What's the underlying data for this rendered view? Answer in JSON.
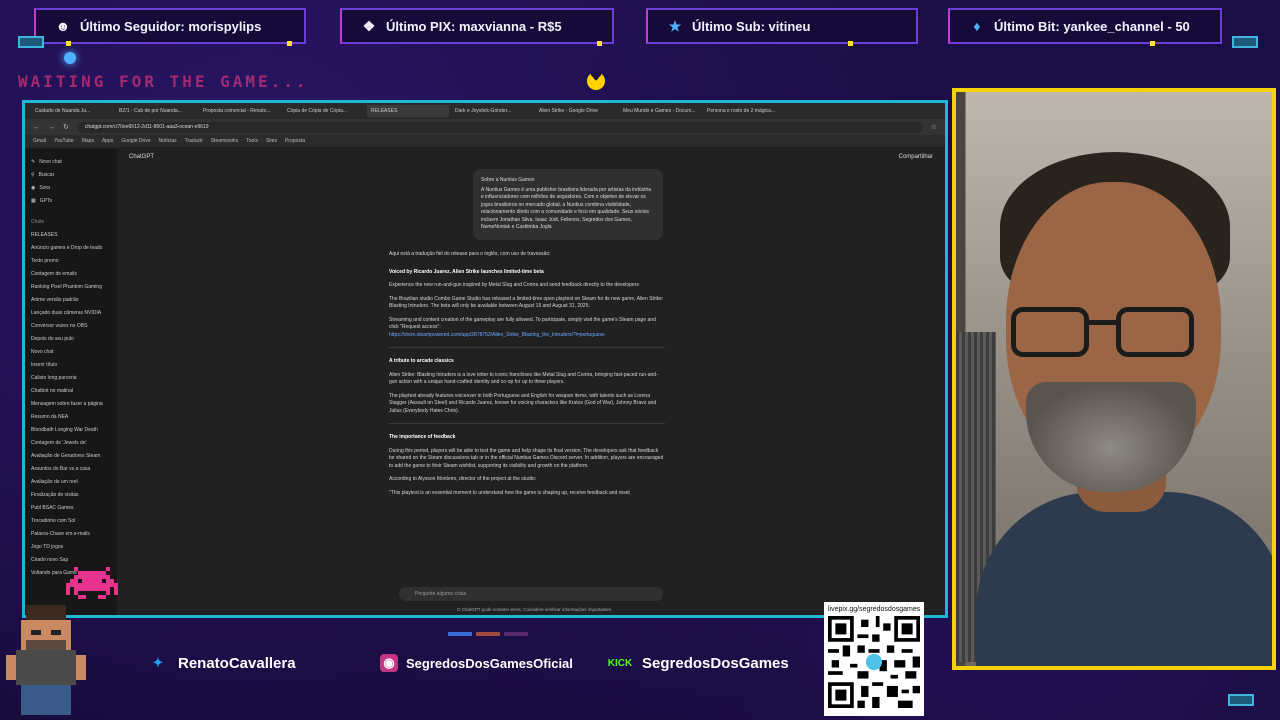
{
  "alerts": [
    {
      "icon": "user-icon",
      "text": "Último Seguidor: morispylips"
    },
    {
      "icon": "pix-icon",
      "text": "Último PIX: maxvianna - R$5"
    },
    {
      "icon": "star-icon",
      "text": "Último Sub: vitineu"
    },
    {
      "icon": "diamond-icon",
      "text": "Último Bit: yankee_channel - 50"
    }
  ],
  "waiting_text": "WAITING FOR THE GAME...",
  "browser": {
    "tabs": [
      "Cuidado de Nuanda Ju...",
      "BZ/1 - Cub de por Nuanda...",
      "Proposta comercial - Renato...",
      "Cópia de Cópia de Cópia...",
      "RELEASES",
      "Dark e Joystick-Grinder...",
      "Alien Strike - Google Drive",
      "Meu Mundo e Games - Docum...",
      "Persona e rosto de 2 mágica..."
    ],
    "active_tab": 4,
    "url": "chatgpt.com/c/70ee6512-2d11-8001-aaa3-ocean-e9619",
    "bookmarks": [
      "Gmail",
      "YouTube",
      "Maps",
      "Apps",
      "Google Drive",
      "Notícias",
      "Traduzir",
      "Steamworks",
      "Tools",
      "Sites",
      "Proposta"
    ]
  },
  "chatgpt": {
    "model": "ChatGPT",
    "share": "Compartilhar",
    "sidebar_top": [
      "Novo chat",
      "Buscar",
      "Sora",
      "GPTs"
    ],
    "sidebar_heading": "Chats",
    "sidebar_items": [
      "RELEASES",
      "Anúncio games e Drop de leads",
      "Texto promo",
      "Contagem de emails",
      "Ranking Pixel Phantom Gaming",
      "Anime versão padrão",
      "Lançado duas câmeras NVIDIA",
      "Conversor vozes no OBS",
      "Depois do seu pulo",
      "Novo chat",
      "Inserir título",
      "Calisto long parceria",
      "Chatbot no matinal",
      "Mensagem sobre fazer a página",
      "Resumo da NEA",
      "Bloodbath Longing War Death",
      "Contagem de 'Jewels de'",
      "Avaliação de Geradores Steam",
      "Assuntos do Bar vs a casa",
      "Avaliação de um reel",
      "Finalização de visitas",
      "Publ BSAC Games",
      "Trocadinho com Sol",
      "Palavra-Chave em e-mails",
      "Jogo TD jogos",
      "Criado novo Sap",
      "Voltando para Game"
    ],
    "bubble_title": "Sobre a Nuntius Games",
    "bubble_text": "A Nuntius Games é uma publisher brasileira liderada por artistas da indústria e influenciadores com milhões de seguidores. Com o objetivo de elevar os jogos brasileiros no mercado global, a Nuntius combina visibilidade, relacionamento direto com a comunidade e foco em qualidade. Seus sócios incluem Jonathan Silva, Isaac Júdi, Felienos, Segredos dos Games, NomeNontak e Casttimba Jogla",
    "intro": "Aqui está a tradução fiel do release para o inglês, com uso de travessão:",
    "headline": "Voiced by Ricardo Juarez, Alien Strike launches limited-time beta",
    "subhead": "Experience the new run-and-gun inspired by Metal Slug and Contra and send feedback directly to the developers",
    "p1": "The Brazilian studio Combo Game Studio has released a limited-time open playtest on Steam for its new game, Alien Strike: Blasting Intruders. The beta will only be available between August 15 and August 31, 2025.",
    "p2": "Streaming and content creation of the gameplay are fully allowed. To participate, simply visit the game's Steam page and click \"Request access\":",
    "link": "https://store.steampowered.com/app/2878752/Alien_Strike_Blasting_the_Intruders/?l=portuguese",
    "h2": "A tribute to arcade classics",
    "p3": "Alien Strike: Blasting Intruders is a love letter to iconic franchises like Metal Slug and Contra, bringing fast-paced run-and-gun action with a unique hand-crafted identity and co-op for up to three players.",
    "p4": "The playtest already features voiceover in both Portuguese and English for weapon items, with talents such as Lorena Stagger (Assault on Steel) and Ricardo Juarez, known for voicing characters like Kratos (God of War), Johnny Bravo and Julius (Everybody Hates Chris).",
    "h3": "The importance of feedback",
    "p5": "During this period, players will be able to test the game and help shape its final version. The developers ask that feedback be shared on the Steam discussions tab or in the official Nuntius Games Discord server. In addition, players are encouraged to add the game to their Steam wishlist, supporting its visibility and growth on the platform.",
    "p6": "According to Alysson Monteiro, director of the project at the studio:",
    "p7": "\"This playtest is an essential moment to understand how the game is shaping up, receive feedback and reset",
    "composer_placeholder": "Pergunte alguma coisa",
    "disclaimer": "O ChatGPT pode cometer erros. Considere verificar informações importantes."
  },
  "socials": [
    {
      "icon": "twitter-icon",
      "label": "RenatoCavallera",
      "color": "#1da1f2"
    },
    {
      "icon": "instagram-icon",
      "label": "SegredosDosGamesOficial",
      "color": "#c13584"
    },
    {
      "icon": "kick-icon",
      "label": "SegredosDosGames",
      "color": "#53fc18",
      "badge": "KICK"
    }
  ],
  "qr_caption": "livepix.gg/segredosdosgames",
  "colors": {
    "frame": "#1fb7d8",
    "cam_border": "#f5d20a",
    "accent": "#6b3fd6"
  }
}
